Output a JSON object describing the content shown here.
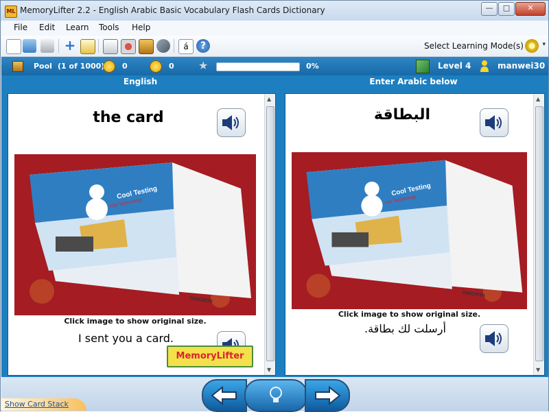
{
  "window": {
    "title": "MemoryLifter 2.2 - English Arabic Basic Vocabulary Flash Cards Dictionary",
    "app_icon_text": "ML",
    "minimize": "—",
    "maximize": "□",
    "close": "✕"
  },
  "menu": {
    "items": [
      "File",
      "Edit",
      "Learn",
      "Tools",
      "Help"
    ]
  },
  "toolbar": {
    "icons": [
      "new-document-icon",
      "open-folder-icon",
      "print-icon",
      "add-icon",
      "edit-icon",
      "slideshow-icon",
      "statistics-icon",
      "notes-icon",
      "settings-tools-icon",
      "character-map-icon",
      "help-icon"
    ],
    "character_map_label": "á",
    "help_label": "?",
    "mode_label": "Select Learning Mode(s)"
  },
  "status": {
    "pool_label": "Pool",
    "pool_count": "(1 of 1000)",
    "right_count": "0",
    "wrong_count": "0",
    "progress_fraction": 0,
    "progress_text": "0%",
    "level": "Level 4",
    "user": "manwei30"
  },
  "question": {
    "header": "English",
    "word": "the card",
    "click_hint": "Click image to show original size.",
    "example": "I sent you a card.",
    "logo_text": "MemoryLifter"
  },
  "answer": {
    "header": "Enter Arabic below",
    "word": "البطاقة",
    "click_hint": "Click image to show original size.",
    "example": "أرسلت لك بطاقة."
  },
  "photo": {
    "card_title": "Cool Testing",
    "card_subtitle": "Hot Technology",
    "brand": "OMICRON"
  },
  "footer": {
    "show_card_stack": "Show Card Stack"
  },
  "colors": {
    "accent": "#1d7fc0",
    "status_bar": "#1769a8"
  }
}
